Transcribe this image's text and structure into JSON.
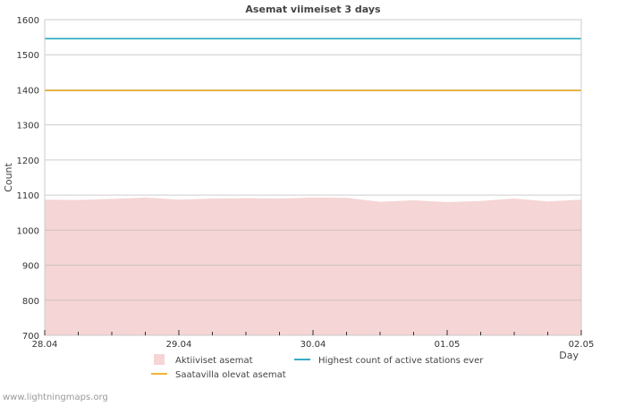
{
  "chart_data": {
    "type": "area",
    "title": "Asemat viimeiset 3 days",
    "xlabel": "Day",
    "ylabel": "Count",
    "ylim": [
      700,
      1600
    ],
    "y_ticks": [
      700,
      800,
      900,
      1000,
      1100,
      1200,
      1300,
      1400,
      1500,
      1600
    ],
    "x_range": [
      "28.04",
      "02.05"
    ],
    "x_tick_labels": [
      "28.04",
      "29.04",
      "30.04",
      "01.05",
      "02.05"
    ],
    "grid": true,
    "legend_position": "bottom",
    "series": [
      {
        "name": "Aktiiviset asemat",
        "kind": "area",
        "color": "#f5d5d5",
        "x": [
          "28.04 00:00",
          "28.04 06:00",
          "28.04 12:00",
          "28.04 18:00",
          "29.04 00:00",
          "29.04 06:00",
          "29.04 12:00",
          "29.04 18:00",
          "30.04 00:00",
          "30.04 06:00",
          "30.04 12:00",
          "30.04 18:00",
          "01.05 00:00",
          "01.05 06:00",
          "01.05 12:00",
          "01.05 18:00",
          "02.05 00:00"
        ],
        "values": [
          1087,
          1086,
          1089,
          1093,
          1087,
          1090,
          1091,
          1090,
          1093,
          1092,
          1081,
          1085,
          1080,
          1083,
          1090,
          1082,
          1087
        ]
      },
      {
        "name": "Highest count of active stations ever",
        "kind": "line",
        "color": "#1aa3b8",
        "x": [
          "28.04 00:00",
          "02.05 00:00"
        ],
        "values": [
          1546,
          1546
        ]
      },
      {
        "name": "Saatavilla olevat asemat",
        "kind": "line",
        "color": "#f0a81e",
        "x": [
          "28.04 00:00",
          "02.05 00:00"
        ],
        "values": [
          1398,
          1398
        ]
      }
    ]
  },
  "footer": {
    "source": "www.lightningmaps.org"
  }
}
